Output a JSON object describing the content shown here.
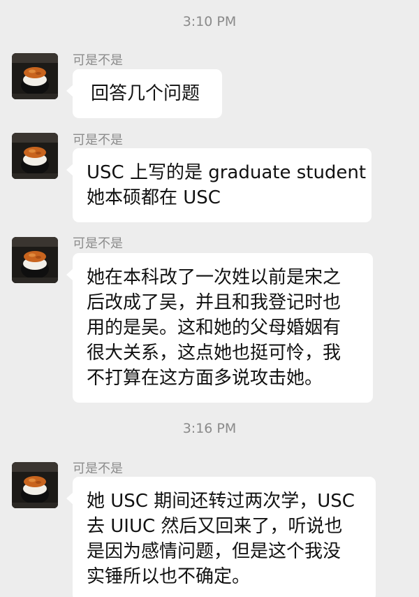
{
  "timestamps": [
    "3:10 PM",
    "3:16 PM"
  ],
  "messages": [
    {
      "sender": "可是不是",
      "lines": [
        "回答几个问题"
      ]
    },
    {
      "sender": "可是不是",
      "lines": [
        "USC 上写的是 graduate student",
        "她本硕都在 USC"
      ]
    },
    {
      "sender": "可是不是",
      "lines": [
        "她在本科改了一次姓以前是宋之",
        "后改成了吴，并且和我登记时也",
        "用的是吴。这和她的父母婚姻有",
        "很大关系，这点她也挺可怜，我",
        "不打算在这方面多说攻击她。"
      ]
    },
    {
      "sender": "可是不是",
      "lines": [
        "她 USC 期间还转过两次学，USC",
        "去 UIUC 然后又回来了，听说也",
        "是因为感情问题，但是这个我没",
        "实锤所以也不确定。"
      ]
    }
  ],
  "colors": {
    "background": "#ededed",
    "bubble": "#ffffff",
    "text": "#111111",
    "meta_text": "#8c8c8c"
  },
  "icons": {
    "avatar": "sushi-avatar-icon"
  }
}
